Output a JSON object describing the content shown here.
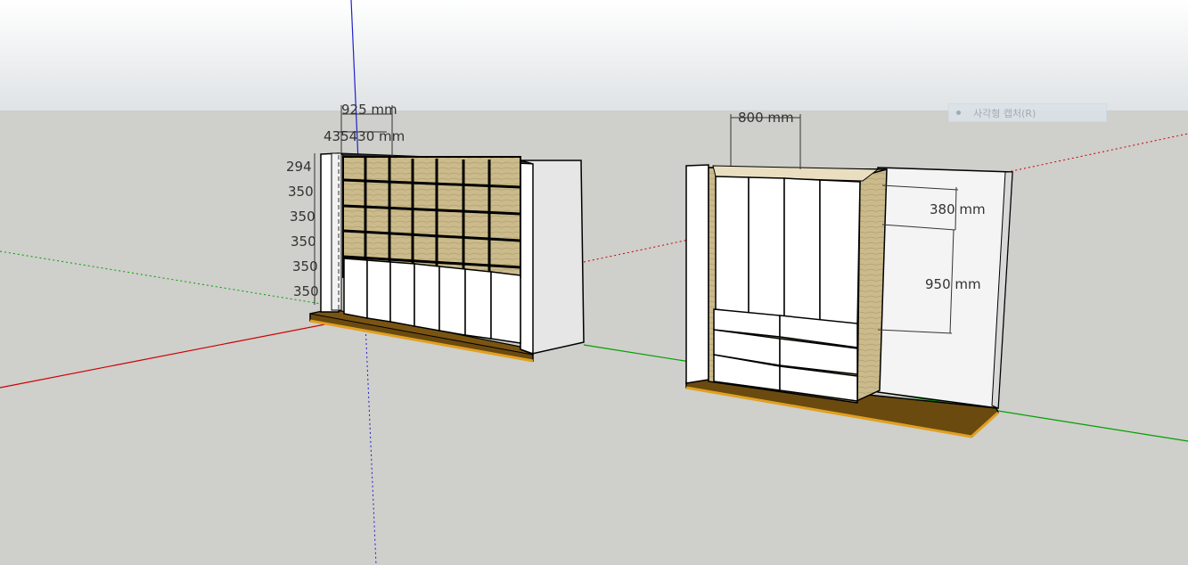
{
  "scene": {
    "colors": {
      "sky_top": "#ffffff",
      "sky_bottom": "#dfe3e5",
      "ground": "#cfcfcb",
      "axis_red": "#cc0000",
      "axis_green": "#00a000",
      "axis_blue": "#2020cc",
      "wood": "#c9b98a",
      "floor_plinth": "#6b4a10",
      "floor_edge": "#e0a020"
    }
  },
  "left_cabinet": {
    "dimensions": {
      "top_width": "925 mm",
      "cell_width": "435430 mm",
      "top_cell_height": "294",
      "row_height_1": "350",
      "row_height_2": "350",
      "row_height_3": "350",
      "row_height_4": "350",
      "row_height_5": "350"
    }
  },
  "right_cabinet": {
    "dimensions": {
      "width": "800 mm",
      "depth": "380 mm",
      "height": "950 mm"
    }
  },
  "tooltip": {
    "label": "사각형 캡처(R)"
  }
}
